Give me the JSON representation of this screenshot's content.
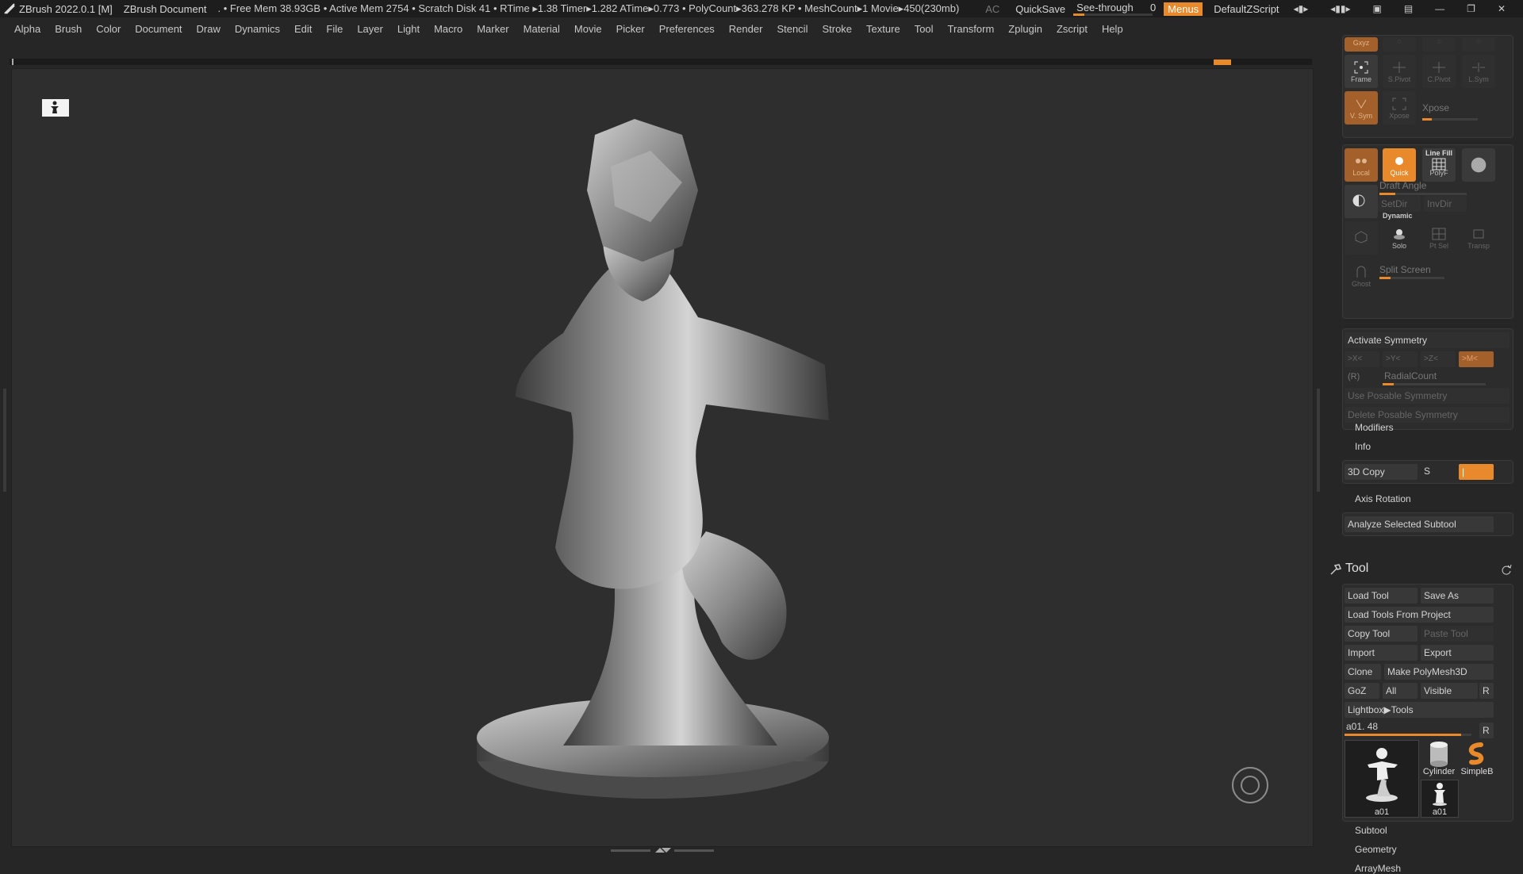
{
  "titlebar": {
    "app": "ZBrush 2022.0.1 [M]",
    "document": "ZBrush Document",
    "stats": ". • Free Mem 38.93GB • Active Mem 2754 • Scratch Disk 41 •  RTime ▸1.38 Timer▸1.282 ATime▸0.773 • PolyCount▸363.278 KP • MeshCount▸1  Movie▸450(230mb)",
    "ac": "AC",
    "quicksave": "QuickSave",
    "see_through_label": "See-through",
    "see_through_value": "0",
    "menus": "Menus",
    "ui_script": "DefaultZScript",
    "accent": "#e8892c"
  },
  "menu": [
    "Alpha",
    "Brush",
    "Color",
    "Document",
    "Draw",
    "Dynamics",
    "Edit",
    "File",
    "Layer",
    "Light",
    "Macro",
    "Marker",
    "Material",
    "Movie",
    "Picker",
    "Preferences",
    "Render",
    "Stencil",
    "Stroke",
    "Texture",
    "Tool",
    "Transform",
    "Zplugin",
    "Zscript",
    "Help"
  ],
  "shelf": {
    "xyz": "Gxyz",
    "frame": "Frame",
    "spivot": "S.Pivot",
    "cpivot": "C.Pivot",
    "lsym": "L.Sym",
    "vsym": "V. Sym",
    "xpose_tile": "Xpose",
    "xpose_label": "Xpose",
    "local": "Local",
    "quick": "Quick",
    "linefill": "Line Fill",
    "polyf": "PolyF",
    "draft_angle": "Draft Angle",
    "setdir": "SetDir",
    "invdir": "InvDir",
    "dynamic": "Dynamic",
    "solo": "Solo",
    "ptsel": "Pt Sel",
    "transp": "Transp",
    "ghost": "Ghost",
    "split_screen": "Split Screen"
  },
  "symmetry": {
    "activate": "Activate Symmetry",
    "x": ">X<",
    "y": ">Y<",
    "z": ">Z<",
    "m": ">M<",
    "r": "(R)",
    "radial": "RadialCount",
    "use_posable": "Use Posable Symmetry",
    "delete_posable": "Delete Posable Symmetry"
  },
  "transform_tail": {
    "modifiers": "Modifiers",
    "info": "Info",
    "copy3d": "3D Copy",
    "s": "S",
    "axis_rotation": "Axis Rotation",
    "analyze": "Analyze Selected Subtool"
  },
  "tool": {
    "title": "Tool",
    "load_tool": "Load Tool",
    "save_as": "Save As",
    "load_from_project": "Load Tools From Project",
    "copy_tool": "Copy Tool",
    "paste_tool": "Paste Tool",
    "import": "Import",
    "export": "Export",
    "clone": "Clone",
    "make_polymesh": "Make PolyMesh3D",
    "goz": "GoZ",
    "all": "All",
    "visible": "Visible",
    "r": "R",
    "lightbox": "Lightbox▶Tools",
    "current": "a01. 48",
    "current_level": 0.92,
    "thumbs": [
      "a01",
      "Cylinder",
      "SimpleB",
      "a01"
    ],
    "subtool": "Subtool",
    "geometry": "Geometry",
    "arraymesh": "ArrayMesh"
  }
}
